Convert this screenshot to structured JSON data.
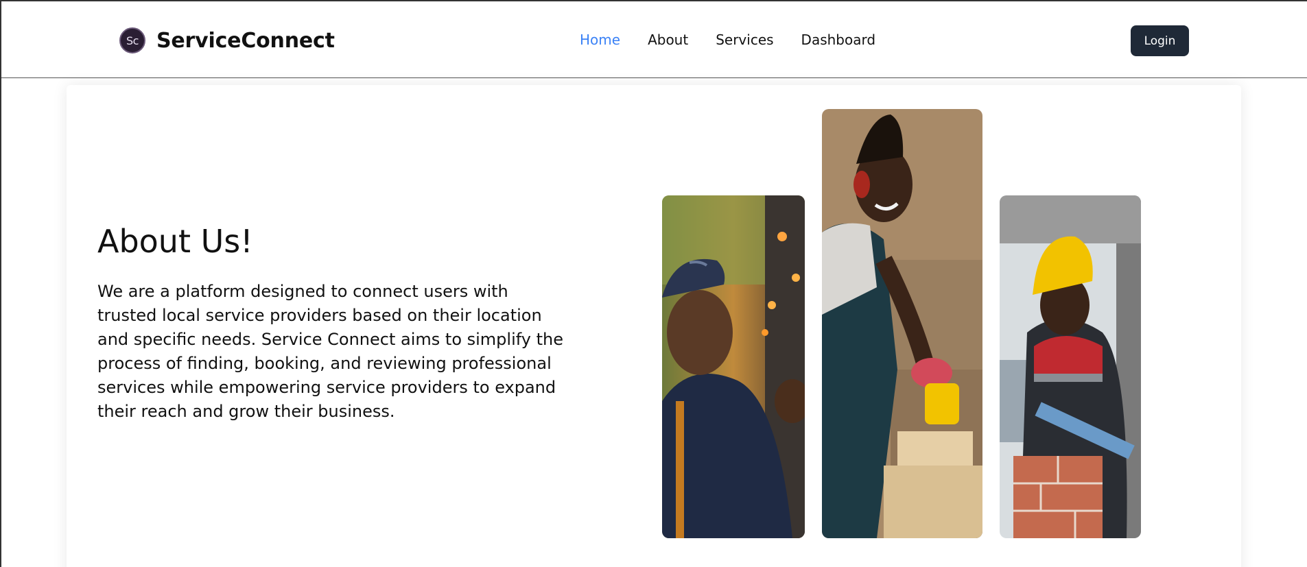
{
  "brand": {
    "logo_initials": "Sc",
    "name": "ServiceConnect"
  },
  "nav": {
    "items": [
      {
        "label": "Home",
        "active": true
      },
      {
        "label": "About",
        "active": false
      },
      {
        "label": "Services",
        "active": false
      },
      {
        "label": "Dashboard",
        "active": false
      }
    ],
    "login_label": "Login"
  },
  "about": {
    "title": "About Us!",
    "body": "We are a platform designed to connect users with trusted local service providers based on their location and specific needs. Service Connect aims to simplify the process of finding, booking, and reviewing professional services while empowering service providers to expand their reach and grow their business."
  },
  "photos": [
    {
      "name": "electrician-photo"
    },
    {
      "name": "woodworker-photo"
    },
    {
      "name": "bricklayer-photo"
    }
  ],
  "colors": {
    "accent": "#3b82f6",
    "button_bg": "#1f2937"
  }
}
